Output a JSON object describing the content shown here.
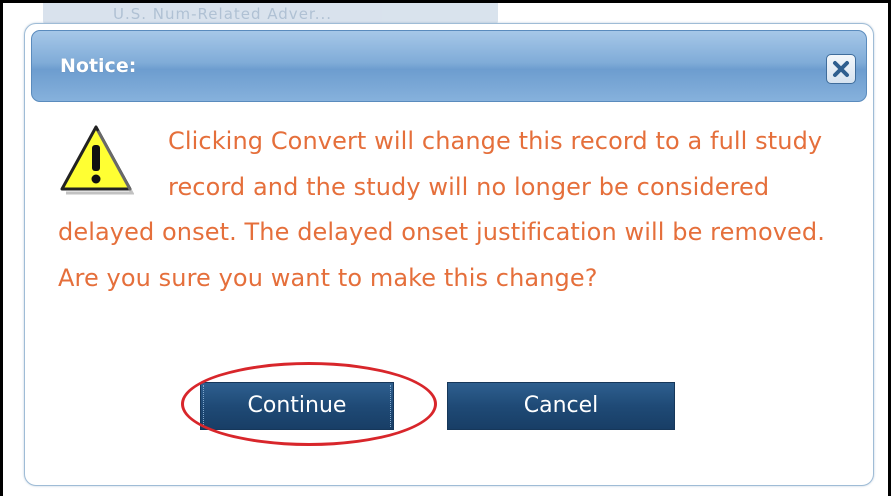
{
  "background": {
    "partial_text": "U.S. Num-Related Adver..."
  },
  "dialog": {
    "title": "Notice:",
    "close_icon": "close-x-icon",
    "warning_icon": "warning-triangle-icon",
    "message": "Clicking Convert will change this record to a full study record and the study will no longer be considered delayed onset. The delayed onset justification will be removed. Are you sure you want to make this change?",
    "buttons": {
      "continue_label": "Continue",
      "cancel_label": "Cancel"
    }
  },
  "colors": {
    "message_text": "#e56f3b",
    "title_bar": "#80acd8",
    "button_bg": "#1f4a76",
    "highlight_ring": "#d8262b"
  }
}
